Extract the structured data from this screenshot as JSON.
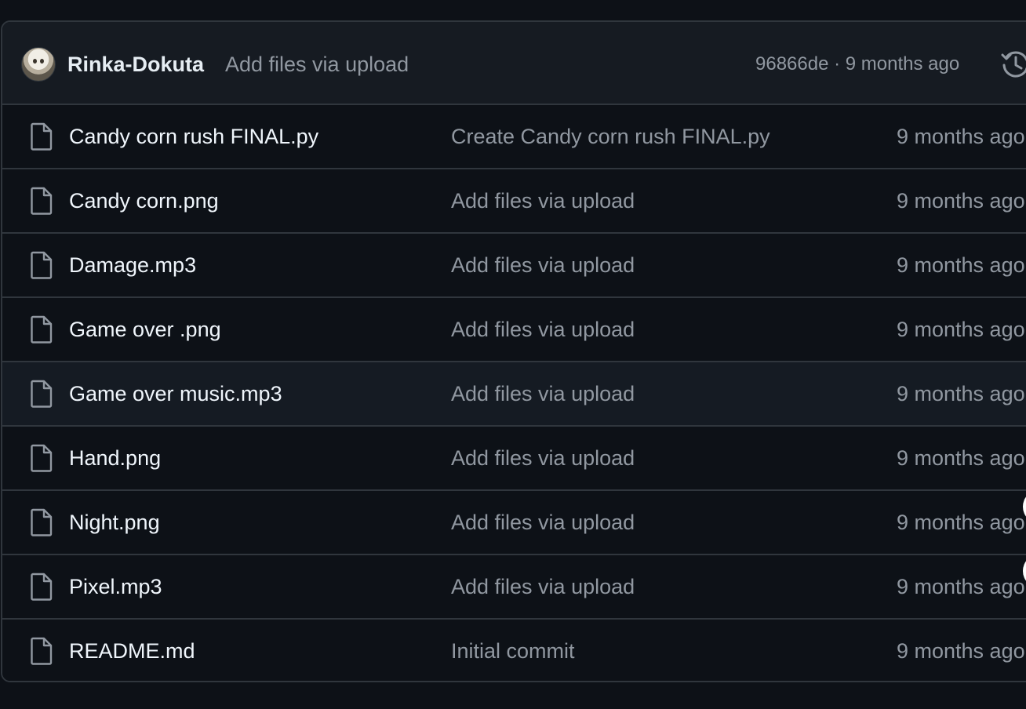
{
  "latest_commit": {
    "author": "Rinka-Dokuta",
    "message": "Add files via upload",
    "meta": "96866de · 9 months ago",
    "history_icon": "history-icon"
  },
  "files": [
    {
      "name": "Candy corn rush FINAL.py",
      "message": "Create Candy corn rush FINAL.py",
      "age": "9 months ago"
    },
    {
      "name": "Candy corn.png",
      "message": "Add files via upload",
      "age": "9 months ago"
    },
    {
      "name": "Damage.mp3",
      "message": "Add files via upload",
      "age": "9 months ago"
    },
    {
      "name": "Game over .png",
      "message": "Add files via upload",
      "age": "9 months ago"
    },
    {
      "name": "Game over music.mp3",
      "message": "Add files via upload",
      "age": "9 months ago"
    },
    {
      "name": "Hand.png",
      "message": "Add files via upload",
      "age": "9 months ago"
    },
    {
      "name": "Night.png",
      "message": "Add files via upload",
      "age": "9 months ago"
    },
    {
      "name": "Pixel.mp3",
      "message": "Add files via upload",
      "age": "9 months ago"
    },
    {
      "name": "README.md",
      "message": "Initial commit",
      "age": "9 months ago"
    }
  ],
  "icons": {
    "file": "file-icon",
    "avatar": "avatar"
  },
  "colors": {
    "background": "#0d1117",
    "header": "#161b22",
    "border": "#30363d",
    "muted_text": "#9198a1",
    "text": "#f0f6fc"
  }
}
